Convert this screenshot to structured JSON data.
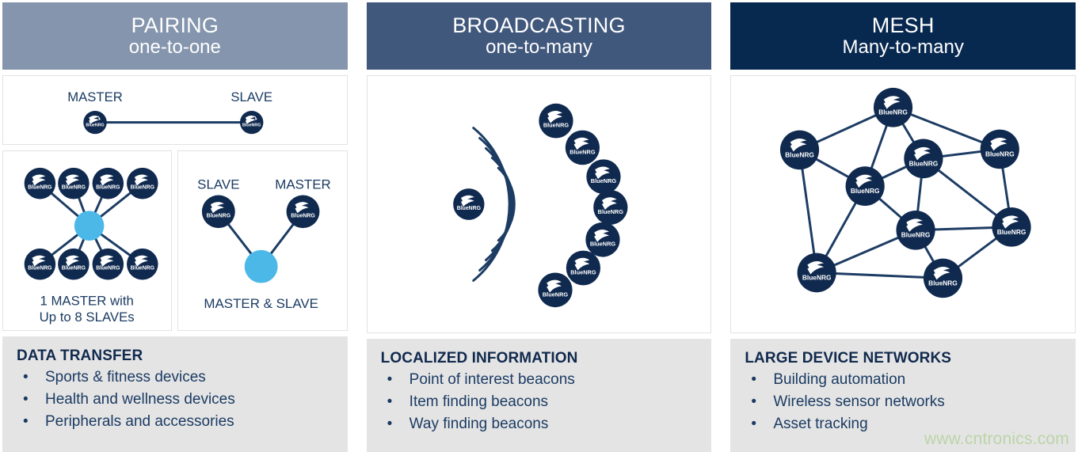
{
  "columns": [
    {
      "id": "pairing",
      "banner": {
        "title": "PAIRING",
        "subtitle": "one-to-one",
        "color": "#8495ad"
      },
      "diagram_top": {
        "label_left": "MASTER",
        "label_right": "SLAVE"
      },
      "diagram_left": {
        "caption_line1": "1 MASTER with",
        "caption_line2": "Up to 8 SLAVEs",
        "hub_color": "#4bb8e8",
        "node_count": 8
      },
      "diagram_right": {
        "label_left": "SLAVE",
        "label_right": "MASTER",
        "caption": "MASTER & SLAVE",
        "hub_color": "#4bb8e8"
      },
      "footer": {
        "title": "DATA TRANSFER",
        "bullets": [
          "Sports & fitness devices",
          "Health and wellness devices",
          "Peripherals and accessories"
        ]
      }
    },
    {
      "id": "broadcasting",
      "banner": {
        "title": "BROADCASTING",
        "subtitle": "one-to-many",
        "color": "#41587d"
      },
      "diagram": {
        "broadcaster_count": 1,
        "receiver_count": 7,
        "wave_arcs": 5
      },
      "footer": {
        "title": "LOCALIZED INFORMATION",
        "bullets": [
          "Point of interest beacons",
          "Item finding beacons",
          "Way finding beacons"
        ]
      }
    },
    {
      "id": "mesh",
      "banner": {
        "title": "MESH",
        "subtitle": "Many-to-many",
        "color": "#07284f"
      },
      "diagram": {
        "node_count": 9,
        "link_count": 19
      },
      "footer": {
        "title": "LARGE DEVICE NETWORKS",
        "bullets": [
          "Building automation",
          "Wireless sensor networks",
          "Asset tracking"
        ]
      }
    }
  ],
  "node_logo_text": "BlueNRG",
  "node_color": "#102a4f",
  "link_color": "#1d3c63",
  "bullet_glyph": "•",
  "watermark": "www.cntronics.com"
}
